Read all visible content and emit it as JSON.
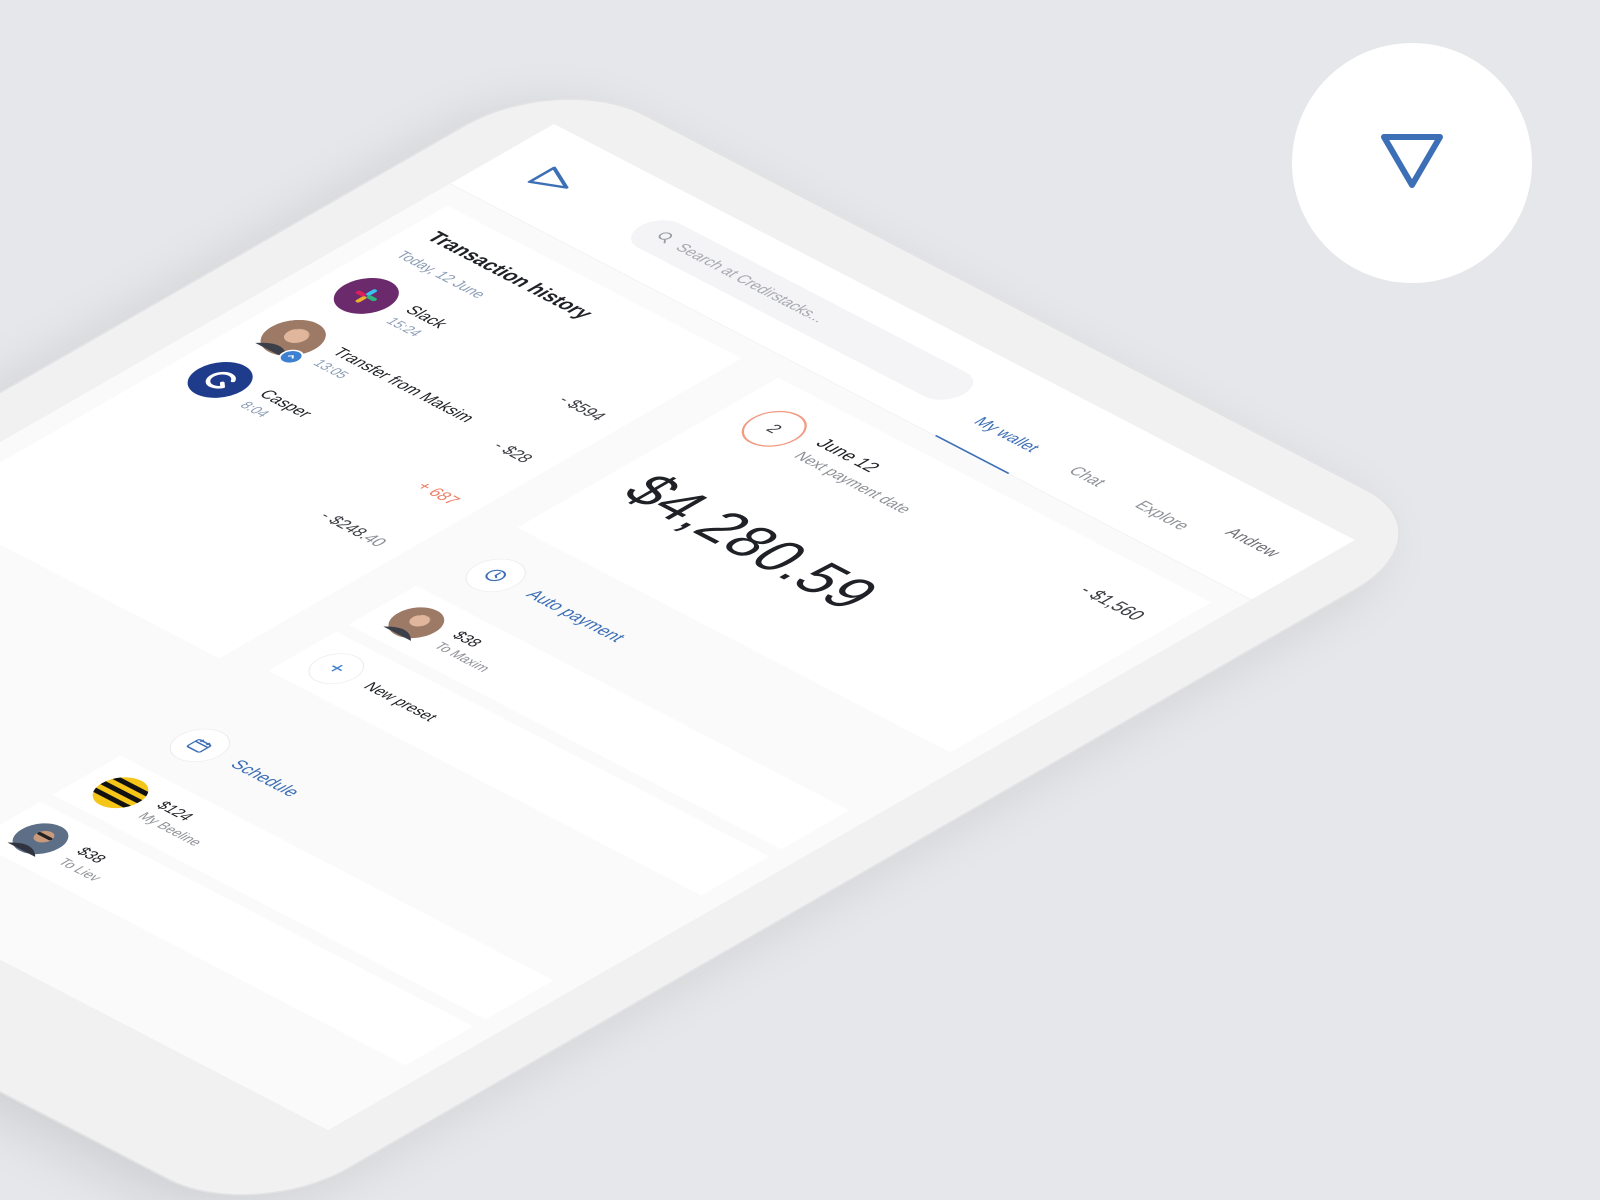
{
  "app": {
    "search_placeholder": "Search at Credirstacks...",
    "tabs": [
      {
        "label": "My wallet",
        "active": true
      },
      {
        "label": "Chat",
        "active": false
      },
      {
        "label": "Explore",
        "active": false
      }
    ],
    "user_name": "Andrew"
  },
  "history": {
    "title": "Transaction history",
    "date": "Today, 12 June",
    "transactions": [
      {
        "name": "Slack",
        "time": "15:24",
        "amount": "- $594",
        "icon": "slack-logo"
      },
      {
        "name": "Transfer from Maksim",
        "time": "13:05",
        "amount": "- $28",
        "icon": "avatar-maksim"
      },
      {
        "name": "Casper",
        "time": "8:04",
        "amount": "+ 687",
        "icon": "casper-logo"
      },
      {
        "name": "",
        "time": "",
        "amount_main": "- $248.",
        "amount_cents": "40"
      }
    ]
  },
  "wallet": {
    "next_payment": {
      "days_left": "2",
      "date": "June 12",
      "label": "Next payment date",
      "amount": "- $1,560"
    },
    "balance": "$4,280.59",
    "auto_payment": {
      "label": "Auto payment",
      "presets": [
        {
          "amount": "$38",
          "label": "To Maxim"
        },
        {
          "label": "New preset"
        }
      ]
    },
    "schedule": {
      "label": "Schedule",
      "items": [
        {
          "amount": "$124",
          "label": "My Beeline"
        },
        {
          "amount": "$38",
          "label": "To Liev"
        }
      ]
    }
  },
  "colors": {
    "accent": "#3d6fb6",
    "positive": "#ee7c63",
    "slack": "#6b2a6b",
    "casper": "#1f3b8c",
    "beeline": "#f5c518"
  }
}
